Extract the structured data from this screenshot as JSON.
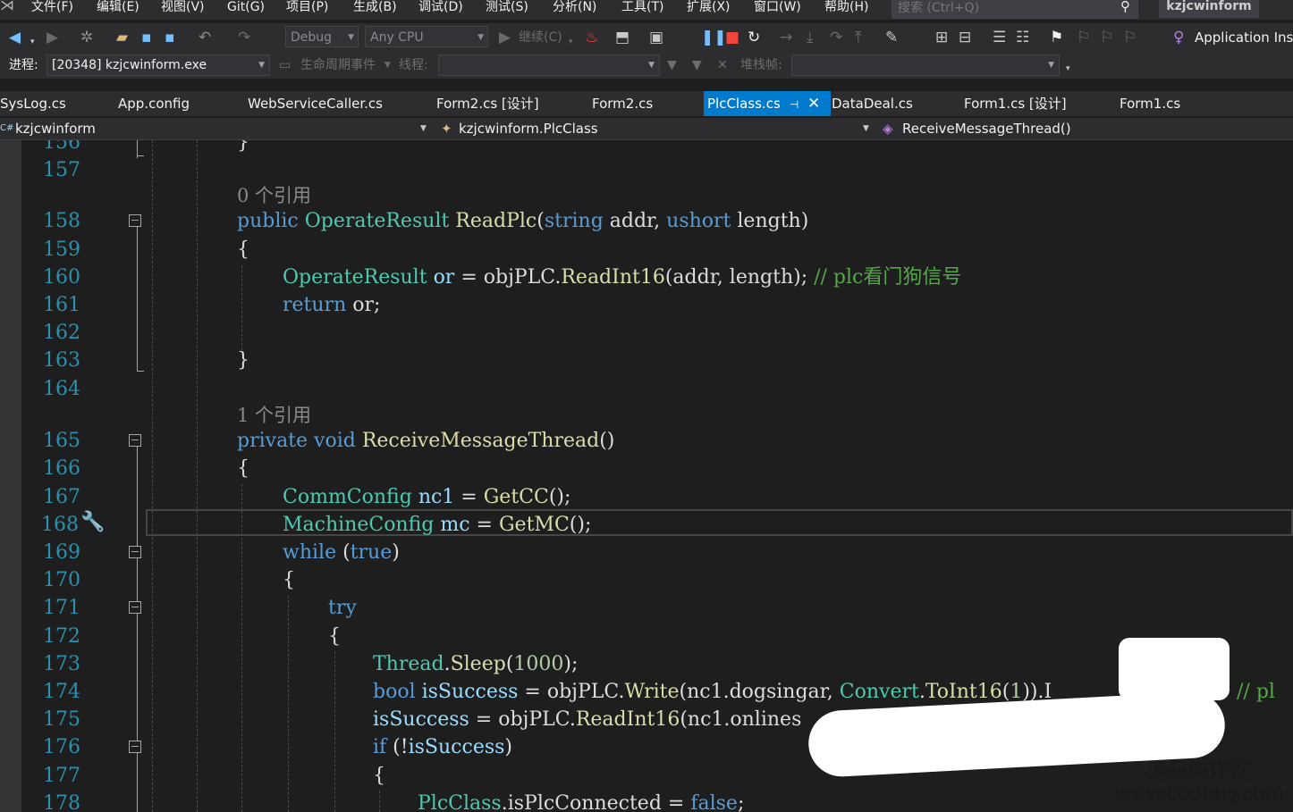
{
  "menu": {
    "items": [
      "文件(F)",
      "编辑(E)",
      "视图(V)",
      "Git(G)",
      "项目(P)",
      "生成(B)",
      "调试(D)",
      "测试(S)",
      "分析(N)",
      "工具(T)",
      "扩展(X)",
      "窗口(W)",
      "帮助(H)"
    ],
    "search_placeholder": "搜索 (Ctrl+Q)",
    "solution_name": "kzjcwinform"
  },
  "toolbar": {
    "config": "Debug",
    "platform": "Any CPU",
    "continue_label": "继续(C)",
    "app_insights": "Application Insi"
  },
  "debugbar": {
    "process_label": "进程:",
    "process_value": "[20348] kzjcwinform.exe",
    "lifecycle_label": "生命周期事件",
    "thread_label": "线程:",
    "stackframe_label": "堆栈帧:"
  },
  "tabs": [
    "SysLog.cs",
    "App.config",
    "WebServiceCaller.cs",
    "Form2.cs [设计]",
    "Form2.cs",
    "PlcClass.cs",
    "DataDeal.cs",
    "Form1.cs [设计]",
    "Form1.cs"
  ],
  "active_tab": "PlcClass.cs",
  "navbar": {
    "project": "kzjcwinform",
    "class": "kzjcwinform.PlcClass",
    "member": "ReceiveMessageThread()"
  },
  "editor": {
    "line_numbers": [
      "156",
      "157",
      "158",
      "159",
      "160",
      "161",
      "162",
      "163",
      "164",
      "165",
      "166",
      "167",
      "168",
      "169",
      "170",
      "171",
      "172",
      "173",
      "174",
      "175",
      "176",
      "177",
      "178"
    ],
    "ref_0": "0 个引用",
    "ref_1": "1 个引用",
    "line156": "}",
    "line158": [
      {
        "t": "public",
        "c": "kw"
      },
      {
        "t": " ",
        "c": ""
      },
      {
        "t": "OperateResult",
        "c": "ty"
      },
      {
        "t": " ",
        "c": ""
      },
      {
        "t": "ReadPlc",
        "c": "fn"
      },
      {
        "t": "(",
        "c": ""
      },
      {
        "t": "string",
        "c": "kw"
      },
      {
        "t": " addr, ",
        "c": ""
      },
      {
        "t": "ushort",
        "c": "kw"
      },
      {
        "t": " length)",
        "c": ""
      }
    ],
    "line159": "{",
    "line160": [
      {
        "t": "OperateResult",
        "c": "ty"
      },
      {
        "t": " ",
        "c": ""
      },
      {
        "t": "or",
        "c": "vr"
      },
      {
        "t": " = objPLC.",
        "c": ""
      },
      {
        "t": "ReadInt16",
        "c": "fn"
      },
      {
        "t": "(addr, length); ",
        "c": ""
      },
      {
        "t": "// plc看门狗信号",
        "c": "cm"
      }
    ],
    "line161": [
      {
        "t": "return",
        "c": "kw"
      },
      {
        "t": " or;",
        "c": ""
      }
    ],
    "line163": "}",
    "line165": [
      {
        "t": "private",
        "c": "kw"
      },
      {
        "t": " ",
        "c": ""
      },
      {
        "t": "void",
        "c": "kw"
      },
      {
        "t": " ",
        "c": ""
      },
      {
        "t": "ReceiveMessageThread",
        "c": "fn"
      },
      {
        "t": "()",
        "c": ""
      }
    ],
    "line166": "{",
    "line167": [
      {
        "t": "CommConfig",
        "c": "ty"
      },
      {
        "t": " ",
        "c": ""
      },
      {
        "t": "nc1",
        "c": "vr"
      },
      {
        "t": " = ",
        "c": ""
      },
      {
        "t": "GetCC",
        "c": "fn"
      },
      {
        "t": "();",
        "c": ""
      }
    ],
    "line168": [
      {
        "t": "MachineConfig",
        "c": "ty"
      },
      {
        "t": " ",
        "c": ""
      },
      {
        "t": "mc",
        "c": "vr"
      },
      {
        "t": " = ",
        "c": ""
      },
      {
        "t": "GetMC",
        "c": "fn"
      },
      {
        "t": "();",
        "c": ""
      }
    ],
    "line169": [
      {
        "t": "while",
        "c": "kw"
      },
      {
        "t": " (",
        "c": ""
      },
      {
        "t": "true",
        "c": "kw"
      },
      {
        "t": ")",
        "c": ""
      }
    ],
    "line170": "{",
    "line171": [
      {
        "t": "try",
        "c": "kw"
      }
    ],
    "line172": "{",
    "line173": [
      {
        "t": "Thread",
        "c": "ty"
      },
      {
        "t": ".",
        "c": ""
      },
      {
        "t": "Sleep",
        "c": "fn"
      },
      {
        "t": "(",
        "c": ""
      },
      {
        "t": "1000",
        "c": "nu"
      },
      {
        "t": ");",
        "c": ""
      }
    ],
    "line174": [
      {
        "t": "bool",
        "c": "kw"
      },
      {
        "t": " ",
        "c": ""
      },
      {
        "t": "isSuccess",
        "c": "vr"
      },
      {
        "t": " = objPLC.",
        "c": ""
      },
      {
        "t": "Write",
        "c": "fn"
      },
      {
        "t": "(nc1.dogsingar, ",
        "c": ""
      },
      {
        "t": "Convert",
        "c": "ty"
      },
      {
        "t": ".",
        "c": ""
      },
      {
        "t": "ToInt16",
        "c": "fn"
      },
      {
        "t": "(",
        "c": ""
      },
      {
        "t": "1",
        "c": "nu"
      },
      {
        "t": ")).I",
        "c": ""
      }
    ],
    "line174_comment": "// pl",
    "line175": [
      {
        "t": "isSuccess",
        "c": "vr"
      },
      {
        "t": " = objPLC.",
        "c": ""
      },
      {
        "t": "ReadInt16",
        "c": "fn"
      },
      {
        "t": "(nc1.onlines",
        "c": ""
      }
    ],
    "line176": [
      {
        "t": "if",
        "c": "kw"
      },
      {
        "t": " (!",
        "c": ""
      },
      {
        "t": "isSuccess",
        "c": "vr"
      },
      {
        "t": ")",
        "c": ""
      }
    ],
    "line177": "{",
    "line178": [
      {
        "t": "PlcClass",
        "c": "ty"
      },
      {
        "t": ".isPlcConnected = ",
        "c": ""
      },
      {
        "t": "false",
        "c": "kw"
      },
      {
        "t": ";",
        "c": ""
      }
    ]
  },
  "watermark": {
    "name": "源码海洋网",
    "url": "www.codehy.com"
  }
}
